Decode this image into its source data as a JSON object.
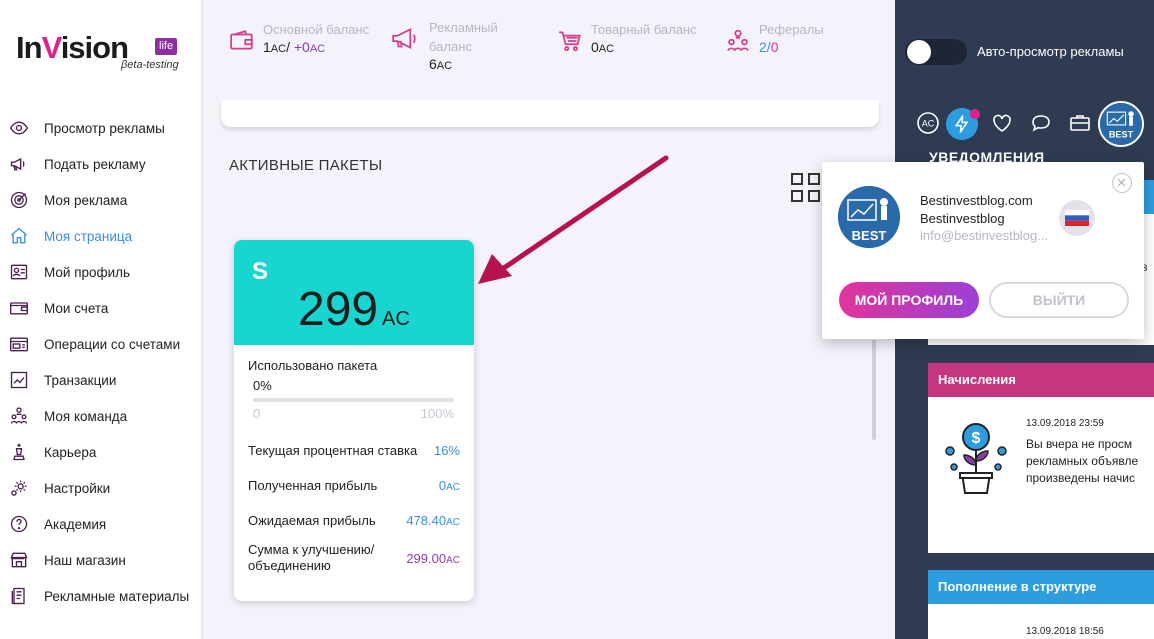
{
  "logo": {
    "brand_left": "In",
    "brand_v": "V",
    "brand_right": "ision",
    "badge": "life",
    "subtitle": "βeta-testing"
  },
  "nav": {
    "items": [
      {
        "label": "Просмотр рекламы",
        "icon": "eye-icon"
      },
      {
        "label": "Подать рекламу",
        "icon": "megaphone-icon"
      },
      {
        "label": "Моя реклама",
        "icon": "target-icon"
      },
      {
        "label": "Моя страница",
        "icon": "home-icon",
        "active": true
      },
      {
        "label": "Мой профиль",
        "icon": "profile-card-icon"
      },
      {
        "label": "Мои счета",
        "icon": "wallet-icon"
      },
      {
        "label": "Операции со счетами",
        "icon": "accounts-icon"
      },
      {
        "label": "Транзакции",
        "icon": "chart-icon"
      },
      {
        "label": "Моя команда",
        "icon": "team-icon"
      },
      {
        "label": "Карьера",
        "icon": "chess-icon"
      },
      {
        "label": "Настройки",
        "icon": "gear-icon"
      },
      {
        "label": "Академия",
        "icon": "question-icon"
      },
      {
        "label": "Наш магазин",
        "icon": "store-icon"
      },
      {
        "label": "Рекламные материалы",
        "icon": "document-icon"
      }
    ]
  },
  "topbar": {
    "main_balance": {
      "label": "Основной баланс",
      "value": "1",
      "unit": "AC",
      "sep": "/",
      "plus": "+0",
      "plus_unit": "AC"
    },
    "ad_balance": {
      "label_line1": "Рекламный",
      "label_line2": "баланс",
      "value": "6",
      "unit": "AC"
    },
    "goods_balance": {
      "label": "Товарный баланс",
      "value": "0",
      "unit": "AC"
    },
    "referrals": {
      "label": "Рефералы",
      "active": "2",
      "sep": "/",
      "inactive": "0"
    }
  },
  "main": {
    "section_title": "АКТИВНЫЕ ПАКЕТЫ",
    "package": {
      "letter": "S",
      "price": "299",
      "currency": "AC",
      "usage_label": "Использовано пакета",
      "usage_percent": "0%",
      "usage_fraction": 0,
      "scale_min": "0",
      "scale_max": "100%",
      "rate_label": "Текущая процентная ставка",
      "rate_value": "16%",
      "profit_label": "Полученная прибыль",
      "profit_value": "0",
      "profit_unit": "AC",
      "expected_label": "Ожидаемая прибыль",
      "expected_value": "478.40",
      "expected_unit": "AC",
      "upgrade_label_line1": "Сумма к улучшению/",
      "upgrade_label_line2": "объединению",
      "upgrade_value": "299.00",
      "upgrade_unit": "AC"
    }
  },
  "rightpanel": {
    "toggle_label": "Авто-просмотр рекламы",
    "toggle_on": false,
    "icons": [
      "ac-coin-icon",
      "lightning-icon",
      "heart-icon",
      "chat-icon",
      "briefcase-icon"
    ],
    "notifications_title": "УВЕДОМЛЕНИЯ",
    "partial_char": "з",
    "accruals": {
      "title": "Начисления",
      "date": "13.09.2018 23:59",
      "line1": "Вы вчера не просм",
      "line2": "рекламных объявле",
      "line3": "произведены начис"
    },
    "structure": {
      "title": "Пополнение в структуре",
      "date": "13.09.2018 18:56"
    }
  },
  "popup": {
    "site": "Bestinvestblog.com",
    "name": "Bestinvestblog",
    "email": "info@bestinvestblog...",
    "profile_button": "МОЙ ПРОФИЛЬ",
    "exit_button": "ВЫЙТИ",
    "avatar_text": "BEST"
  },
  "colors": {
    "accent_cyan": "#19d5d0",
    "accent_pink": "#e1218a",
    "accent_purple": "#8a3fa8",
    "accent_blue": "#3a8fd6",
    "panel_dark": "#2f3b52",
    "accruals_head": "#c6357f",
    "structure_head": "#2e9de0"
  }
}
